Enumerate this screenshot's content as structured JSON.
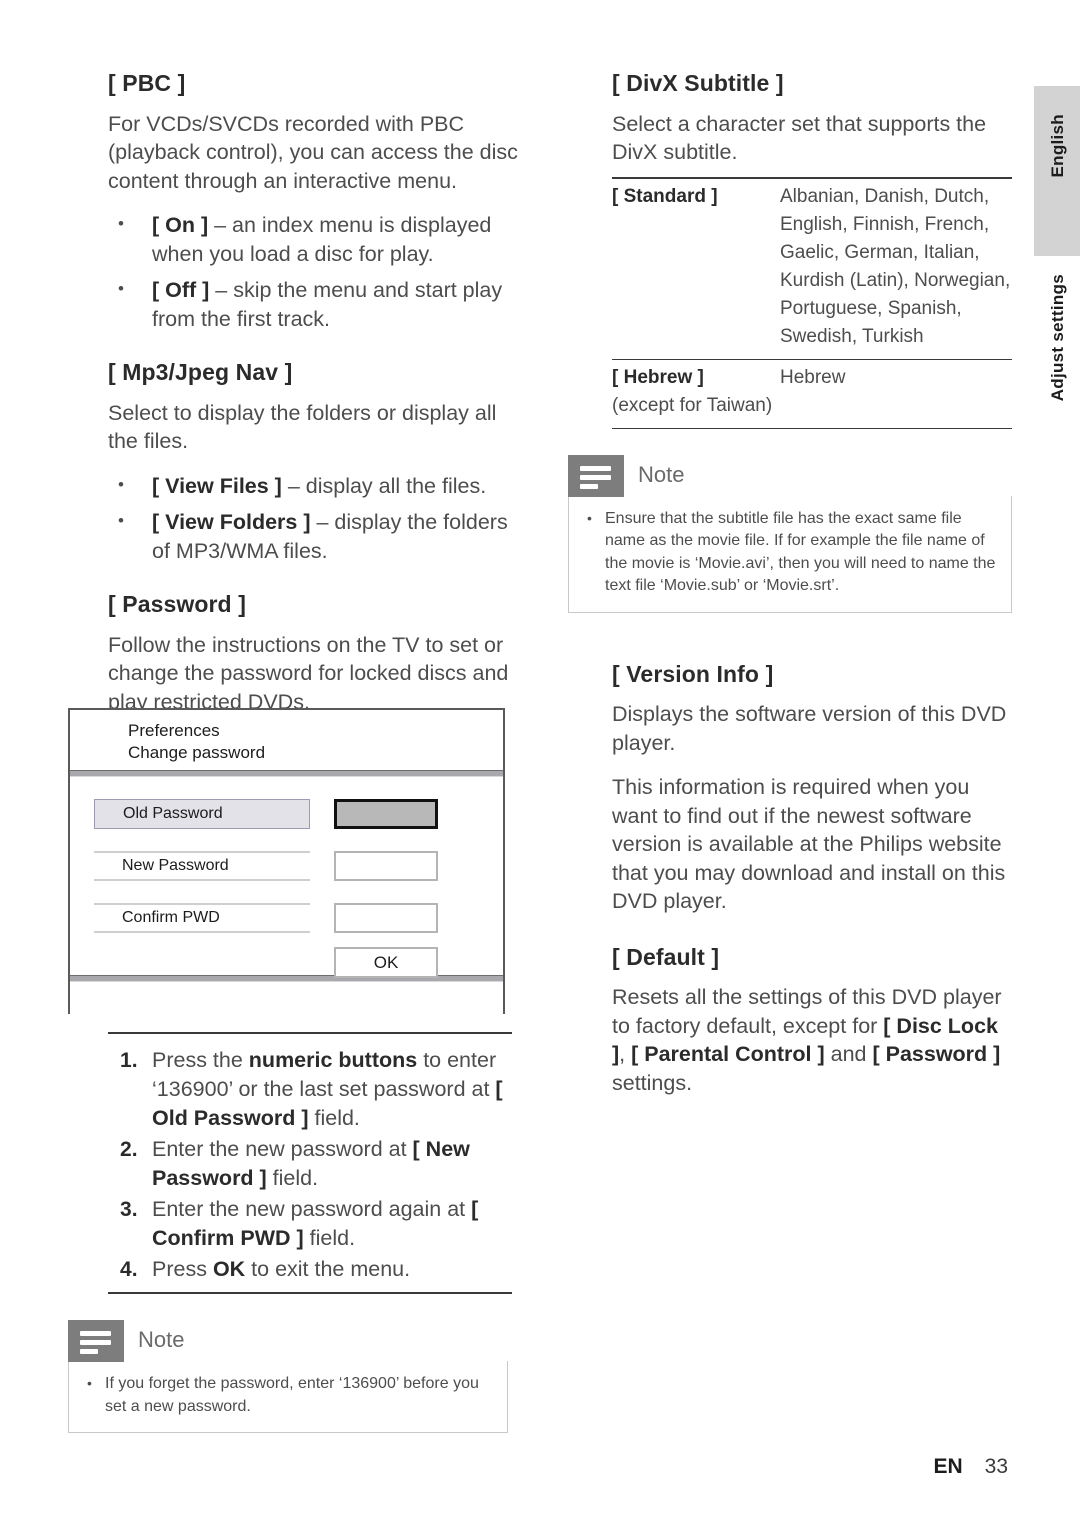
{
  "left_column": {
    "pbc": {
      "heading": "[ PBC ]",
      "paragraph": "For VCDs/SVCDs recorded with PBC (playback control), you can access the disc content through an interactive menu.",
      "bullets": [
        {
          "option": "[ On ]",
          "desc": " – an index menu is displayed when you load a disc for play."
        },
        {
          "option": "[ Off ]",
          "desc": " – skip the menu and start play from the first track."
        }
      ]
    },
    "mp3jpeg": {
      "heading": "[ Mp3/Jpeg Nav ]",
      "paragraph": "Select to display the folders or display all the files.",
      "bullets": [
        {
          "option": "[ View Files ]",
          "desc": " – display all the files."
        },
        {
          "option": "[ View Folders ]",
          "desc": " – display the folders of MP3/WMA files."
        }
      ]
    },
    "password": {
      "heading": "[ Password ]",
      "paragraph": "Follow the instructions on the TV to set or change the password for locked discs and play restricted DVDs."
    },
    "steps": [
      {
        "pre": "Press the ",
        "bold1": "numeric buttons",
        "mid": " to enter ‘136900’ or the last set password at ",
        "bold2": "[ Old Password ]",
        "post": " field."
      },
      {
        "pre": "Enter the new password at ",
        "bold1": "[ New Password ]",
        "mid": "",
        "bold2": "",
        "post": " field."
      },
      {
        "pre": "Enter the new password again at ",
        "bold1": "[ Confirm PWD ]",
        "mid": "",
        "bold2": "",
        "post": " field."
      },
      {
        "pre": "Press ",
        "bold1": "OK",
        "mid": "",
        "bold2": "",
        "post": " to exit the menu."
      }
    ],
    "note": {
      "title": "Note",
      "items": [
        "If you forget the password, enter ‘136900’ before you set a new password."
      ]
    }
  },
  "dialog": {
    "title_line1": "Preferences",
    "title_line2": "Change password",
    "fields": [
      {
        "label": "Old Password",
        "value": "",
        "state": "selected"
      },
      {
        "label": "New Password",
        "value": "",
        "state": "normal"
      },
      {
        "label": "Confirm PWD",
        "value": "",
        "state": "normal"
      }
    ],
    "ok_label": "OK"
  },
  "right_column": {
    "divx": {
      "heading": "[ DivX Subtitle ]",
      "paragraph": "Select a character set that supports the DivX subtitle."
    },
    "charset_table": {
      "rows": [
        {
          "option": "[ Standard ]",
          "option_sub": "",
          "languages": "Albanian, Danish, Dutch, English, Finnish, French, Gaelic, German, Italian, Kurdish (Latin), Norwegian, Portuguese, Spanish, Swedish, Turkish"
        },
        {
          "option": "[ Hebrew ]",
          "option_sub": "(except for Taiwan)",
          "languages": "Hebrew"
        }
      ]
    },
    "note": {
      "title": "Note",
      "items": [
        "Ensure that the subtitle file has the exact same file name as the movie file. If for example the file name of the movie is ‘Movie.avi’, then you will need to name the text file ‘Movie.sub’ or ‘Movie.srt’."
      ]
    },
    "version_info": {
      "heading": "[ Version Info ]",
      "paragraph1": "Displays the software version of this DVD player.",
      "paragraph2": "This information is required when you want to find out if the newest software version is available at the Philips website that you may download and install on this DVD player."
    },
    "default": {
      "heading": "[ Default ]",
      "text_pre": "Resets all the settings of this DVD player to factory default, except for ",
      "bold1": "[ Disc Lock ]",
      "text_mid1": ", ",
      "bold2": "[ Parental Control ]",
      "text_mid2": " and ",
      "bold3": "[ Password ]",
      "text_post": " settings."
    }
  },
  "side_tabs": {
    "language_tab": "English",
    "section_tab": "Adjust settings"
  },
  "footer": {
    "locale": "EN",
    "page_number": "33"
  }
}
